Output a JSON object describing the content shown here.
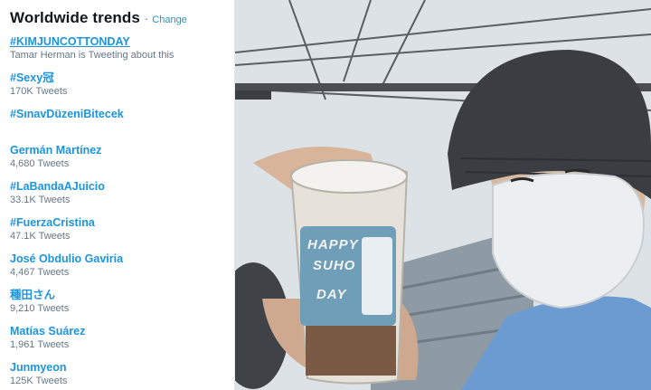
{
  "trends": {
    "title": "Worldwide trends",
    "separator": "·",
    "change_label": "Change",
    "items": [
      {
        "name": "#KIMJUNCOTTONDAY",
        "meta": "Tamar Herman is Tweeting about this"
      },
      {
        "name": "#Sexy冠",
        "meta": "170K Tweets"
      },
      {
        "name": "#SınavDüzeniBitecek",
        "meta": ""
      },
      {
        "name": "Germán Martínez",
        "meta": "4,680 Tweets"
      },
      {
        "name": "#LaBandaAJuicio",
        "meta": "33.1K Tweets"
      },
      {
        "name": "#FuerzaCristina",
        "meta": "47.1K Tweets"
      },
      {
        "name": "José Obdulio Gaviria",
        "meta": "4,467 Tweets"
      },
      {
        "name": "種田さん",
        "meta": "9,210 Tweets"
      },
      {
        "name": "Matías Suárez",
        "meta": "1,961 Tweets"
      },
      {
        "name": "Junmyeon",
        "meta": "125K Tweets"
      }
    ]
  },
  "photo": {
    "cup_text": [
      "HAPPY",
      "SUHO",
      "DAY"
    ]
  },
  "colors": {
    "link": "#1b95e0",
    "title": "#14171a",
    "meta": "#657786",
    "beanie": "#3a3d42",
    "mask": "#e9ecef",
    "sky": "#dfe3e7",
    "cup_label": "#6f9fb8"
  }
}
